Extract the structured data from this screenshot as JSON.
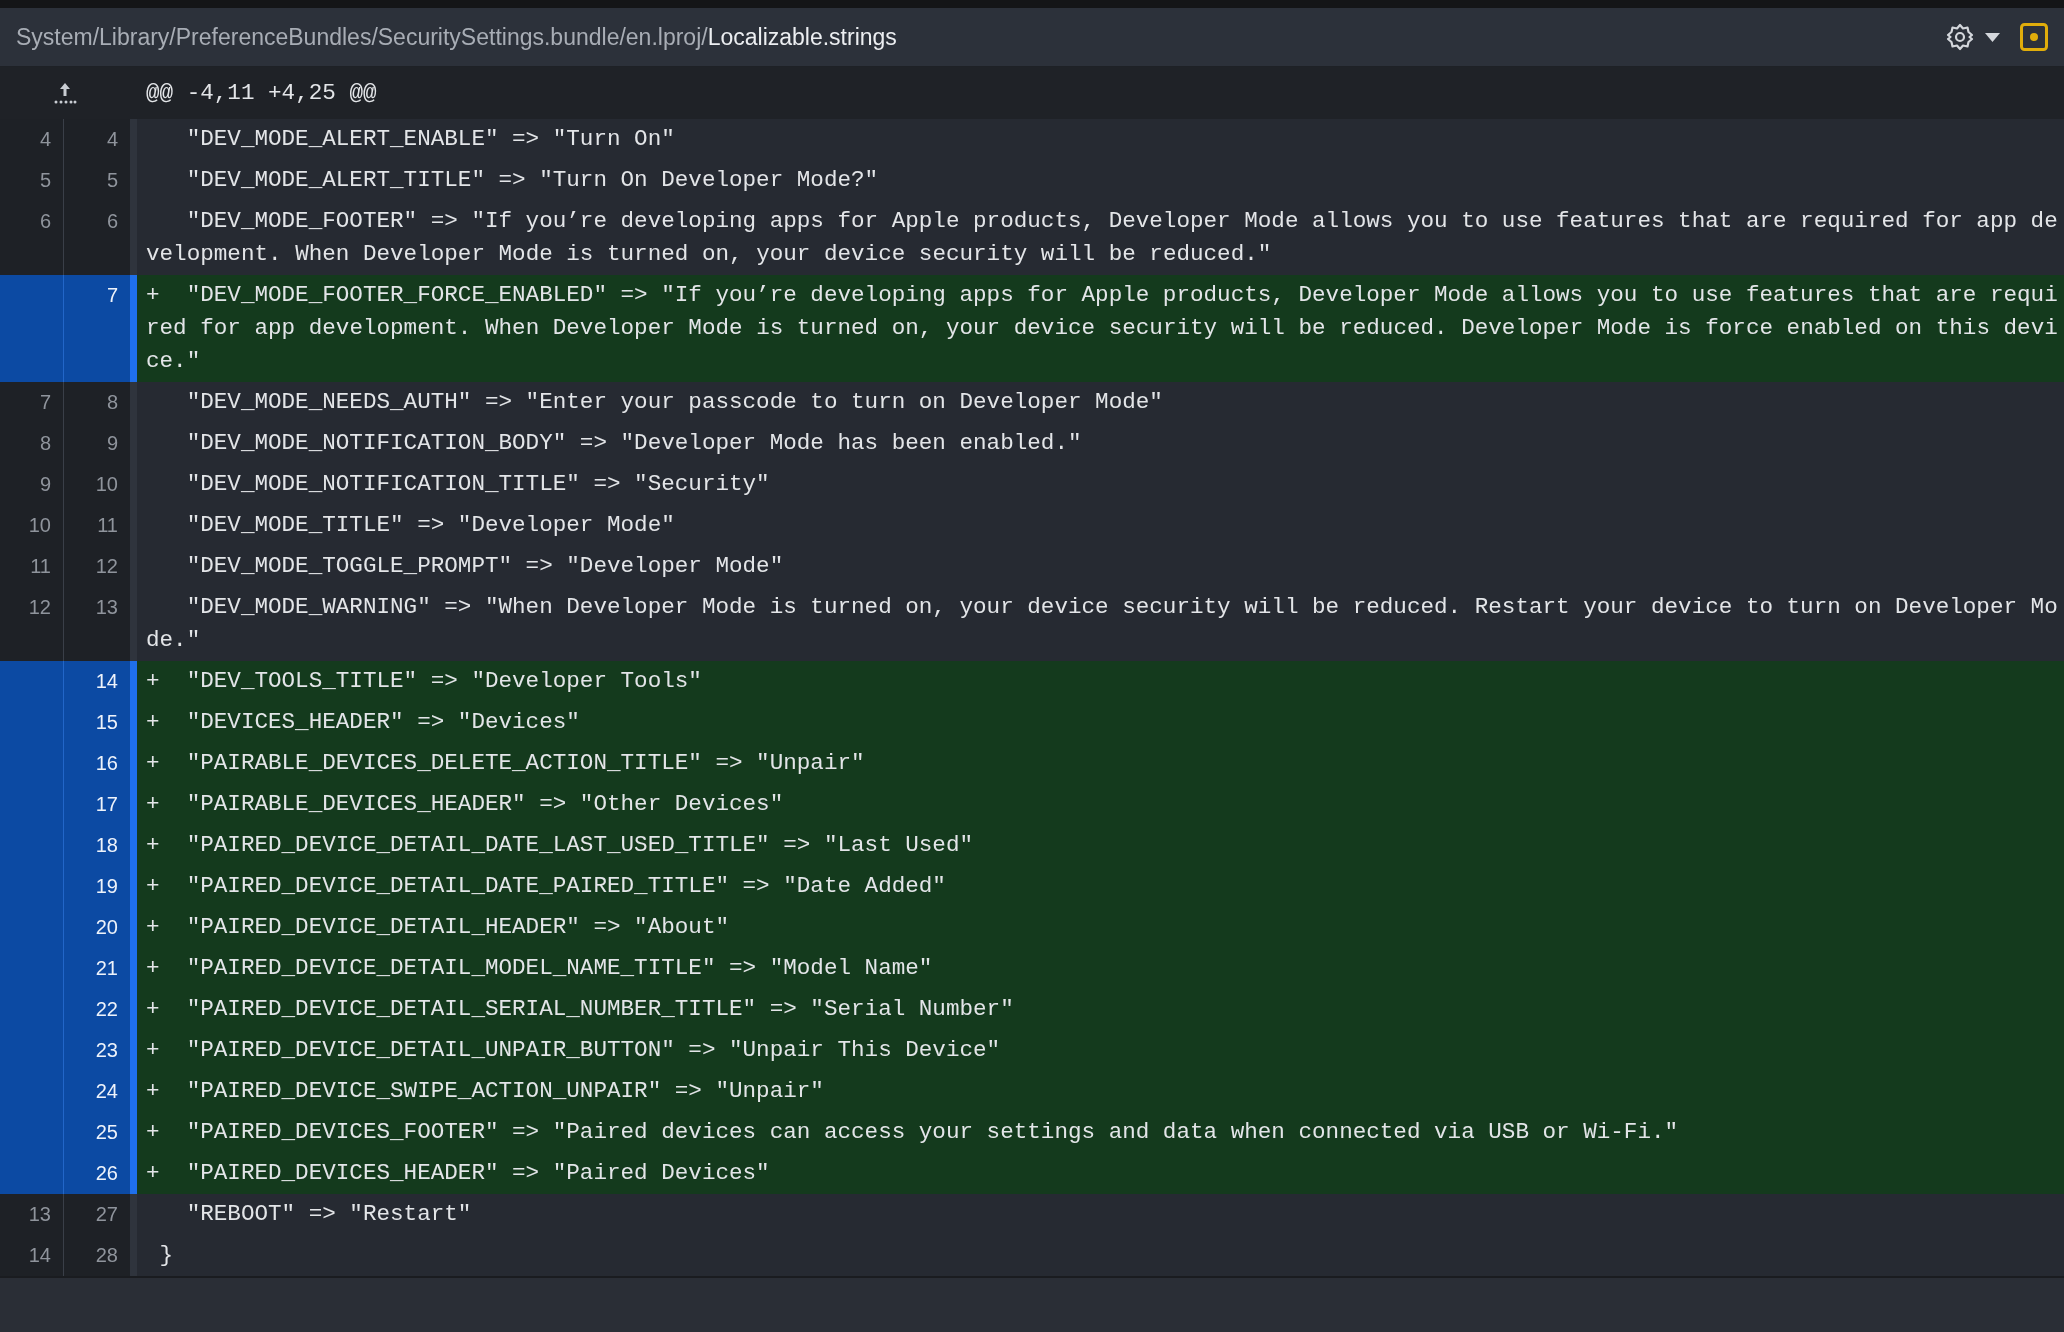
{
  "file_header": {
    "path": "System/Library/PreferenceBundles/SecuritySettings.bundle/en.lproj/",
    "filename": "Localizable.strings"
  },
  "hunk": {
    "header": "@@ -4,11 +4,25 @@"
  },
  "lines": [
    {
      "kind": "context",
      "old": "4",
      "new": "4",
      "indented": true,
      "code": "\"DEV_MODE_ALERT_ENABLE\" => \"Turn On\""
    },
    {
      "kind": "context",
      "old": "5",
      "new": "5",
      "indented": true,
      "code": "\"DEV_MODE_ALERT_TITLE\" => \"Turn On Developer Mode?\""
    },
    {
      "kind": "context",
      "old": "6",
      "new": "6",
      "indented": true,
      "code": "\"DEV_MODE_FOOTER\" => \"If you’re developing apps for Apple products, Developer Mode allows you to use features that are required for app development. When Developer Mode is turned on, your device security will be reduced.\""
    },
    {
      "kind": "added",
      "marker": "+",
      "new": "7",
      "indented": true,
      "code": "\"DEV_MODE_FOOTER_FORCE_ENABLED\" => \"If you’re developing apps for Apple products, Developer Mode allows you to use features that are required for app development. When Developer Mode is turned on, your device security will be reduced. Developer Mode is force enabled on this device.\""
    },
    {
      "kind": "context",
      "old": "7",
      "new": "8",
      "indented": true,
      "code": "\"DEV_MODE_NEEDS_AUTH\" => \"Enter your passcode to turn on Developer Mode\""
    },
    {
      "kind": "context",
      "old": "8",
      "new": "9",
      "indented": true,
      "code": "\"DEV_MODE_NOTIFICATION_BODY\" => \"Developer Mode has been enabled.\""
    },
    {
      "kind": "context",
      "old": "9",
      "new": "10",
      "indented": true,
      "code": "\"DEV_MODE_NOTIFICATION_TITLE\" => \"Security\""
    },
    {
      "kind": "context",
      "old": "10",
      "new": "11",
      "indented": true,
      "code": "\"DEV_MODE_TITLE\" => \"Developer Mode\""
    },
    {
      "kind": "context",
      "old": "11",
      "new": "12",
      "indented": true,
      "code": "\"DEV_MODE_TOGGLE_PROMPT\" => \"Developer Mode\""
    },
    {
      "kind": "context",
      "old": "12",
      "new": "13",
      "indented": true,
      "code": "\"DEV_MODE_WARNING\" => \"When Developer Mode is turned on, your device security will be reduced. Restart your device to turn on Developer Mode.\""
    },
    {
      "kind": "added",
      "marker": "+",
      "new": "14",
      "indented": true,
      "code": "\"DEV_TOOLS_TITLE\" => \"Developer Tools\""
    },
    {
      "kind": "added",
      "marker": "+",
      "new": "15",
      "indented": true,
      "code": "\"DEVICES_HEADER\" => \"Devices\""
    },
    {
      "kind": "added",
      "marker": "+",
      "new": "16",
      "indented": true,
      "code": "\"PAIRABLE_DEVICES_DELETE_ACTION_TITLE\" => \"Unpair\""
    },
    {
      "kind": "added",
      "marker": "+",
      "new": "17",
      "indented": true,
      "code": "\"PAIRABLE_DEVICES_HEADER\" => \"Other Devices\""
    },
    {
      "kind": "added",
      "marker": "+",
      "new": "18",
      "indented": true,
      "code": "\"PAIRED_DEVICE_DETAIL_DATE_LAST_USED_TITLE\" => \"Last Used\""
    },
    {
      "kind": "added",
      "marker": "+",
      "new": "19",
      "indented": true,
      "code": "\"PAIRED_DEVICE_DETAIL_DATE_PAIRED_TITLE\" => \"Date Added\""
    },
    {
      "kind": "added",
      "marker": "+",
      "new": "20",
      "indented": true,
      "code": "\"PAIRED_DEVICE_DETAIL_HEADER\" => \"About\""
    },
    {
      "kind": "added",
      "marker": "+",
      "new": "21",
      "indented": true,
      "code": "\"PAIRED_DEVICE_DETAIL_MODEL_NAME_TITLE\" => \"Model Name\""
    },
    {
      "kind": "added",
      "marker": "+",
      "new": "22",
      "indented": true,
      "code": "\"PAIRED_DEVICE_DETAIL_SERIAL_NUMBER_TITLE\" => \"Serial Number\""
    },
    {
      "kind": "added",
      "marker": "+",
      "new": "23",
      "indented": true,
      "code": "\"PAIRED_DEVICE_DETAIL_UNPAIR_BUTTON\" => \"Unpair This Device\""
    },
    {
      "kind": "added",
      "marker": "+",
      "new": "24",
      "indented": true,
      "code": "\"PAIRED_DEVICE_SWIPE_ACTION_UNPAIR\" => \"Unpair\""
    },
    {
      "kind": "added",
      "marker": "+",
      "new": "25",
      "indented": true,
      "code": "\"PAIRED_DEVICES_FOOTER\" => \"Paired devices can access your settings and data when connected via USB or Wi-Fi.\""
    },
    {
      "kind": "added",
      "marker": "+",
      "new": "26",
      "indented": true,
      "code": "\"PAIRED_DEVICES_HEADER\" => \"Paired Devices\""
    },
    {
      "kind": "context",
      "old": "13",
      "new": "27",
      "indented": true,
      "code": "\"REBOOT\" => \"Restart\""
    },
    {
      "kind": "context",
      "old": "14",
      "new": "28",
      "indented": false,
      "code": "}"
    }
  ]
}
